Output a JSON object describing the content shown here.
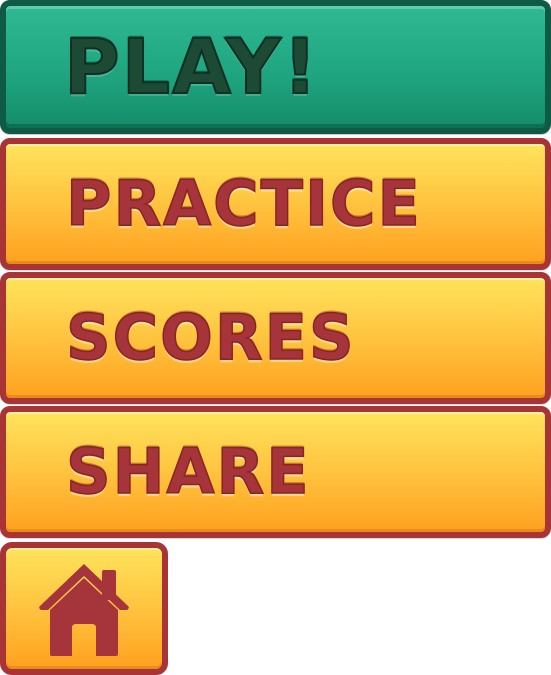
{
  "menu": {
    "play_label": "PLAY!",
    "practice_label": "PRACTICE",
    "scores_label": "SCORES",
    "share_label": "SHARE",
    "home_icon": "home-icon"
  },
  "colors": {
    "play_fill": "#1fa680",
    "play_border": "#0f5a45",
    "play_text": "#1d4a35",
    "button_fill_top": "#ffe35c",
    "button_fill_bottom": "#ffa11f",
    "button_border": "#a93436",
    "button_text": "#a5353a"
  }
}
